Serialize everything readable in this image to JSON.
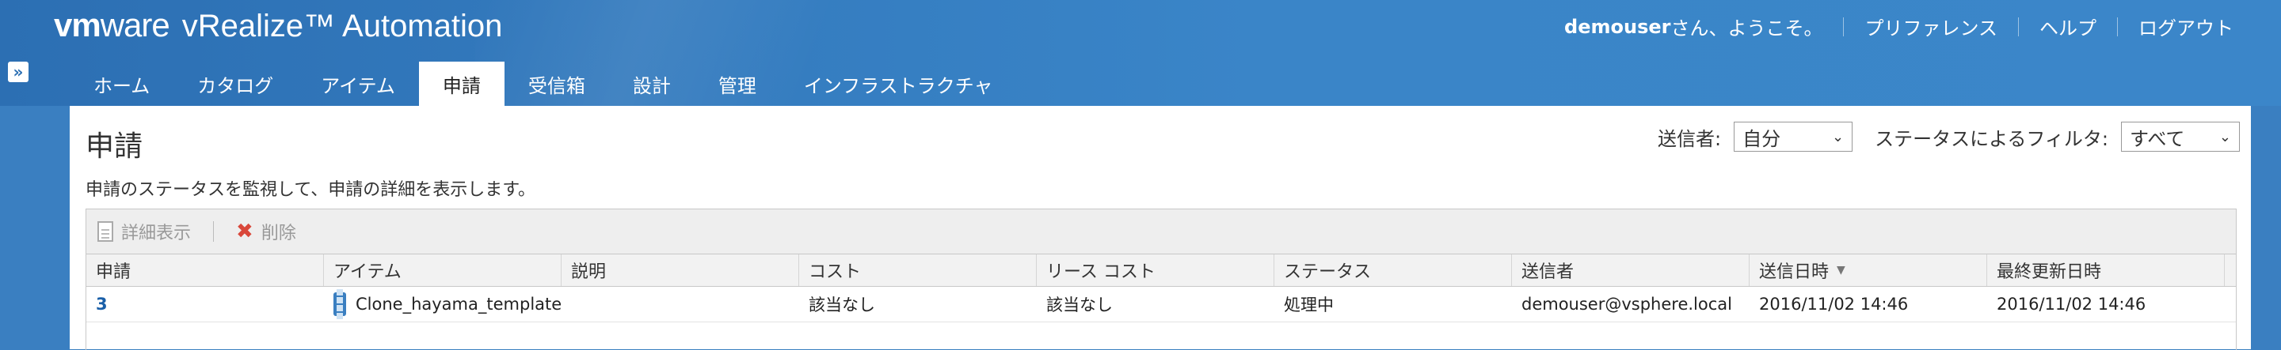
{
  "header": {
    "brand_vm": "vm",
    "brand_ware": "ware",
    "product": "vRealize™ Automation",
    "user": "demouser",
    "welcome": "さん、ようこそ。",
    "links": [
      "プリファレンス",
      "ヘルプ",
      "ログアウト"
    ]
  },
  "tabs": [
    {
      "label": "ホーム"
    },
    {
      "label": "カタログ"
    },
    {
      "label": "アイテム"
    },
    {
      "label": "申請"
    },
    {
      "label": "受信箱"
    },
    {
      "label": "設計"
    },
    {
      "label": "管理"
    },
    {
      "label": "インフラストラクチャ"
    }
  ],
  "active_tab": "申請",
  "page": {
    "title": "申請",
    "description": "申請のステータスを監視して、申請の詳細を表示します。"
  },
  "filters": {
    "sender_label": "送信者:",
    "sender_value": "自分",
    "status_label": "ステータスによるフィルタ:",
    "status_value": "すべて"
  },
  "toolbar": {
    "details_label": "詳細表示",
    "delete_label": "削除"
  },
  "table": {
    "columns": [
      "申請",
      "アイテム",
      "説明",
      "コスト",
      "リース コスト",
      "ステータス",
      "送信者",
      "送信日時",
      "最終更新日時"
    ],
    "sorted_column": "送信日時",
    "rows": [
      [
        "3",
        "Clone_hayama_template",
        "",
        "該当なし",
        "該当なし",
        "処理中",
        "demouser@vsphere.local",
        "2016/11/02 14:46",
        "2016/11/02 14:46"
      ]
    ]
  },
  "colors": {
    "header_blue": "#3a7fc1",
    "link_blue": "#1a5fa8",
    "delete_red": "#d9473a"
  }
}
